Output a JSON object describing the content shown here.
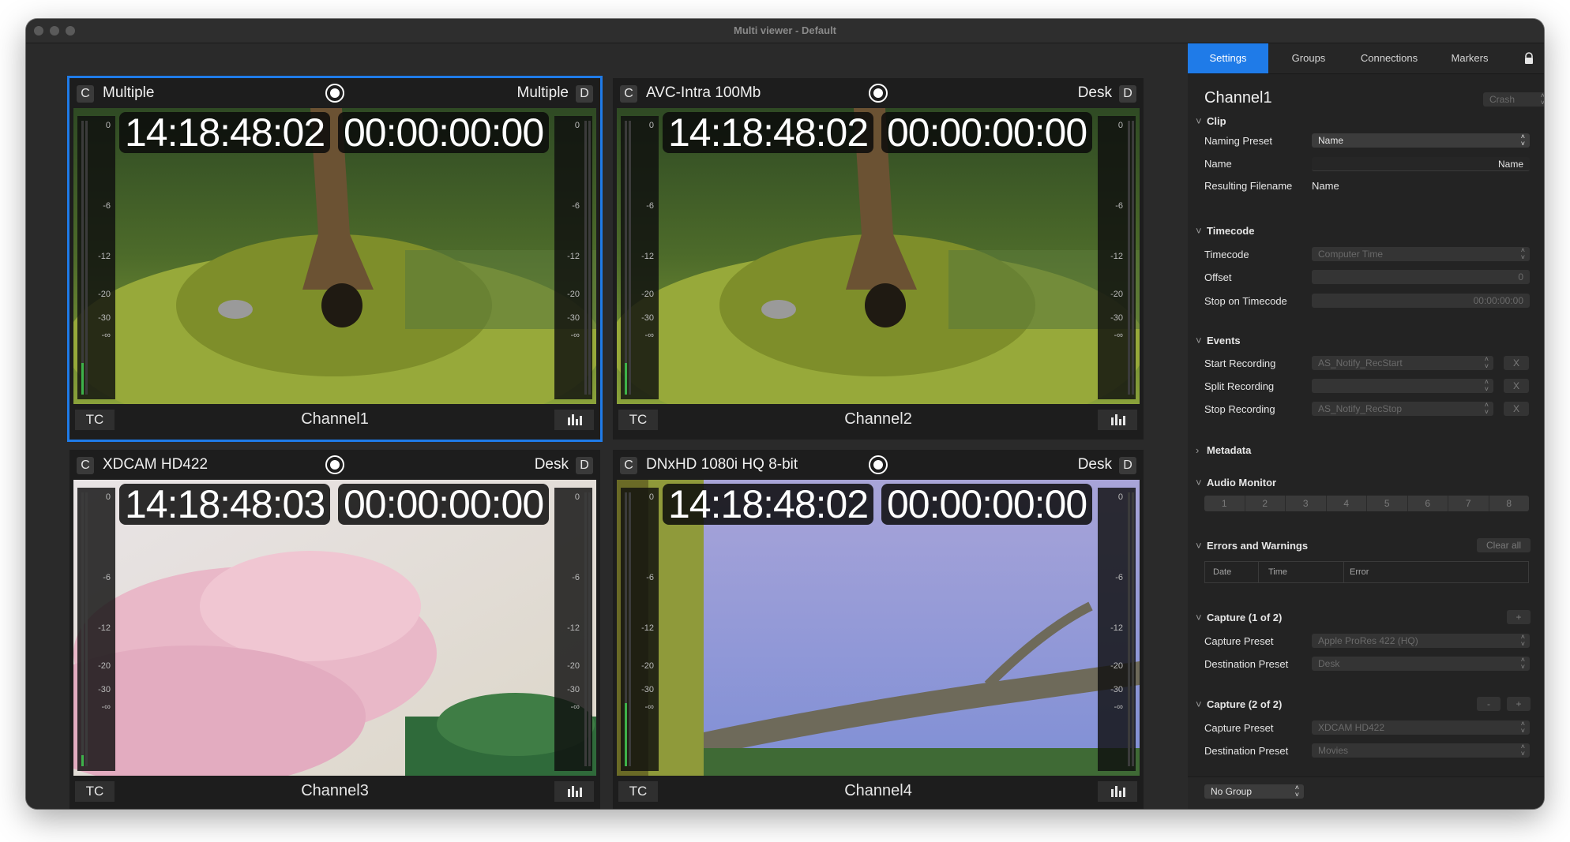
{
  "window": {
    "title": "Multi viewer - Default"
  },
  "tiles": [
    {
      "left_badge": "C",
      "preset": "Multiple",
      "destination": "Multiple",
      "right_badge": "D",
      "timecode": "14:18:48:02",
      "duration": "00:00:00:00",
      "tc_button": "TC",
      "channel": "Channel1",
      "meter_ticks": [
        "0",
        "-6",
        "-12",
        "-20",
        "-30",
        "-∞"
      ],
      "selected": true
    },
    {
      "left_badge": "C",
      "preset": "AVC-Intra 100Mb",
      "destination": "Desk",
      "right_badge": "D",
      "timecode": "14:18:48:02",
      "duration": "00:00:00:00",
      "tc_button": "TC",
      "channel": "Channel2",
      "meter_ticks": [
        "0",
        "-6",
        "-12",
        "-20",
        "-30",
        "-∞"
      ],
      "selected": false
    },
    {
      "left_badge": "C",
      "preset": "XDCAM HD422",
      "destination": "Desk",
      "right_badge": "D",
      "timecode": "14:18:48:03",
      "duration": "00:00:00:00",
      "tc_button": "TC",
      "channel": "Channel3",
      "meter_ticks": [
        "0",
        "-6",
        "-12",
        "-20",
        "-30",
        "-∞"
      ],
      "selected": false
    },
    {
      "left_badge": "C",
      "preset": "DNxHD 1080i HQ 8-bit",
      "destination": "Desk",
      "right_badge": "D",
      "timecode": "14:18:48:02",
      "duration": "00:00:00:00",
      "tc_button": "TC",
      "channel": "Channel4",
      "meter_ticks": [
        "0",
        "-6",
        "-12",
        "-20",
        "-30",
        "-∞"
      ],
      "selected": false
    }
  ],
  "sidebar": {
    "tabs": [
      "Settings",
      "Groups",
      "Connections",
      "Markers"
    ],
    "active_tab": "Settings",
    "channel_title": "Channel1",
    "crash_value": "Crash",
    "clip": {
      "section": "Clip",
      "naming_preset_label": "Naming Preset",
      "naming_preset_value": "Name",
      "name_label": "Name",
      "name_value": "Name",
      "resulting_filename_label": "Resulting Filename",
      "resulting_filename_value": "Name"
    },
    "timecode": {
      "section": "Timecode",
      "timecode_label": "Timecode",
      "timecode_value": "Computer Time",
      "offset_label": "Offset",
      "offset_value": "0",
      "stop_label": "Stop on Timecode",
      "stop_value": "00:00:00:00"
    },
    "events": {
      "section": "Events",
      "start_label": "Start Recording",
      "start_value": "AS_Notify_RecStart",
      "split_label": "Split Recording",
      "split_value": "",
      "stop_label": "Stop Recording",
      "stop_value": "AS_Notify_RecStop",
      "clear_button": "X"
    },
    "metadata": {
      "section": "Metadata"
    },
    "audio_monitor": {
      "section": "Audio Monitor",
      "channels": [
        "1",
        "2",
        "3",
        "4",
        "5",
        "6",
        "7",
        "8"
      ]
    },
    "errors": {
      "section": "Errors and Warnings",
      "clear_all": "Clear all",
      "columns": [
        "Date",
        "Time",
        "Error"
      ]
    },
    "capture1": {
      "section": "Capture (1 of 2)",
      "add_button": "+",
      "capture_preset_label": "Capture Preset",
      "capture_preset_value": "Apple ProRes 422 (HQ)",
      "destination_label": "Destination Preset",
      "destination_value": "Desk"
    },
    "capture2": {
      "section": "Capture (2 of 2)",
      "remove_button": "-",
      "add_button": "+",
      "capture_preset_label": "Capture Preset",
      "capture_preset_value": "XDCAM HD422",
      "destination_label": "Destination Preset",
      "destination_value": "Movies"
    },
    "group_select": "No Group"
  },
  "colors": {
    "accent": "#1f7be8",
    "meter_green": "#3db24a"
  }
}
